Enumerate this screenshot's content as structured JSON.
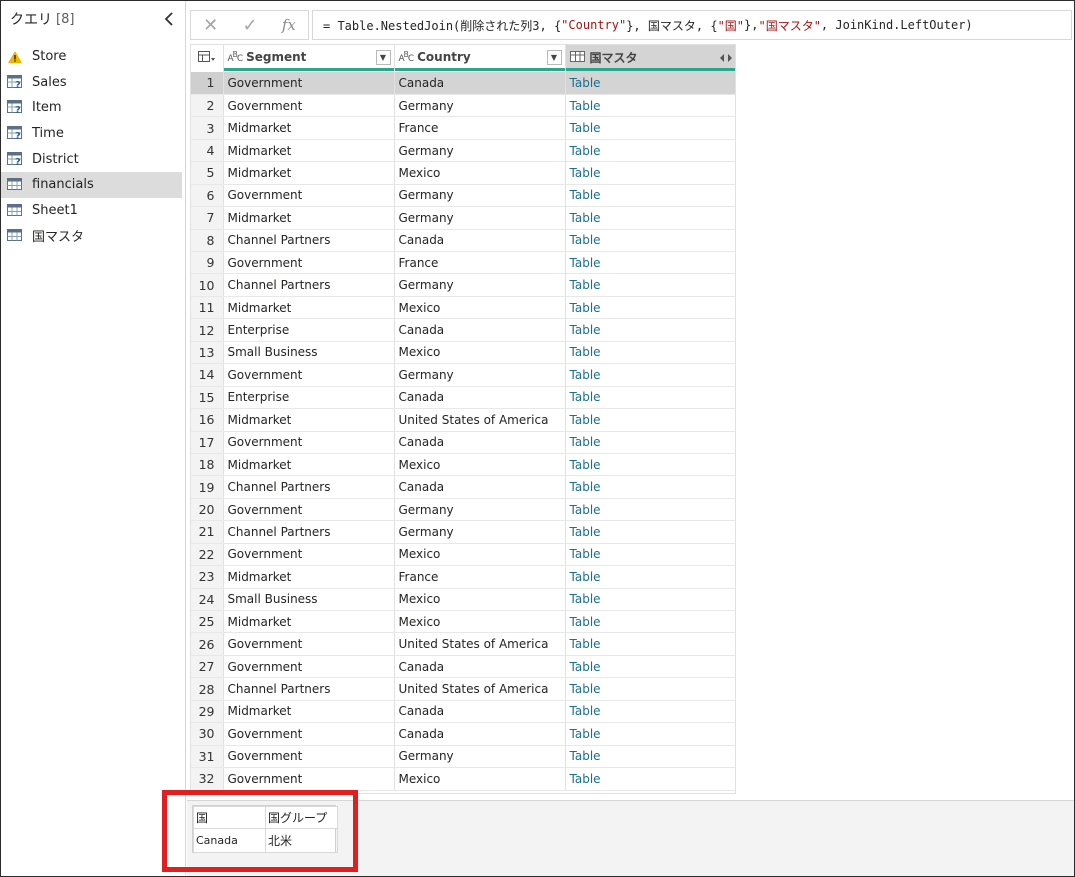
{
  "queries": {
    "title": "クエリ",
    "count": "[8]",
    "items": [
      {
        "label": "Store",
        "icon": "warning-icon"
      },
      {
        "label": "Sales",
        "icon": "query-table-icon"
      },
      {
        "label": "Item",
        "icon": "query-table-icon"
      },
      {
        "label": "Time",
        "icon": "query-table-icon"
      },
      {
        "label": "District",
        "icon": "query-table-icon"
      },
      {
        "label": "financials",
        "icon": "table-icon",
        "selected": true
      },
      {
        "label": "Sheet1",
        "icon": "table-icon"
      },
      {
        "label": "国マスタ",
        "icon": "table-icon"
      }
    ]
  },
  "formula_bar": {
    "cancel": "✕",
    "commit": "✓",
    "fx": "fx",
    "formula_parts": [
      {
        "t": "= Table.NestedJoin(削除された列3, {",
        "s": false
      },
      {
        "t": "\"Country\"",
        "s": true
      },
      {
        "t": "}, 国マスタ, {",
        "s": false
      },
      {
        "t": "\"国\"",
        "s": true
      },
      {
        "t": "}, ",
        "s": false
      },
      {
        "t": "\"国マスタ\"",
        "s": true
      },
      {
        "t": ", JoinKind.LeftOuter)",
        "s": false
      }
    ]
  },
  "grid": {
    "columns": [
      {
        "label": "Segment",
        "type_icon": "ABC"
      },
      {
        "label": "Country",
        "type_icon": "ABC"
      },
      {
        "label": "国マスタ",
        "type_icon": "table"
      }
    ],
    "rows": [
      [
        "1",
        "Government",
        "Canada",
        "Table"
      ],
      [
        "2",
        "Government",
        "Germany",
        "Table"
      ],
      [
        "3",
        "Midmarket",
        "France",
        "Table"
      ],
      [
        "4",
        "Midmarket",
        "Germany",
        "Table"
      ],
      [
        "5",
        "Midmarket",
        "Mexico",
        "Table"
      ],
      [
        "6",
        "Government",
        "Germany",
        "Table"
      ],
      [
        "7",
        "Midmarket",
        "Germany",
        "Table"
      ],
      [
        "8",
        "Channel Partners",
        "Canada",
        "Table"
      ],
      [
        "9",
        "Government",
        "France",
        "Table"
      ],
      [
        "10",
        "Channel Partners",
        "Germany",
        "Table"
      ],
      [
        "11",
        "Midmarket",
        "Mexico",
        "Table"
      ],
      [
        "12",
        "Enterprise",
        "Canada",
        "Table"
      ],
      [
        "13",
        "Small Business",
        "Mexico",
        "Table"
      ],
      [
        "14",
        "Government",
        "Germany",
        "Table"
      ],
      [
        "15",
        "Enterprise",
        "Canada",
        "Table"
      ],
      [
        "16",
        "Midmarket",
        "United States of America",
        "Table"
      ],
      [
        "17",
        "Government",
        "Canada",
        "Table"
      ],
      [
        "18",
        "Midmarket",
        "Mexico",
        "Table"
      ],
      [
        "19",
        "Channel Partners",
        "Canada",
        "Table"
      ],
      [
        "20",
        "Government",
        "Germany",
        "Table"
      ],
      [
        "21",
        "Channel Partners",
        "Germany",
        "Table"
      ],
      [
        "22",
        "Government",
        "Mexico",
        "Table"
      ],
      [
        "23",
        "Midmarket",
        "France",
        "Table"
      ],
      [
        "24",
        "Small Business",
        "Mexico",
        "Table"
      ],
      [
        "25",
        "Midmarket",
        "Mexico",
        "Table"
      ],
      [
        "26",
        "Government",
        "United States of America",
        "Table"
      ],
      [
        "27",
        "Government",
        "Canada",
        "Table"
      ],
      [
        "28",
        "Channel Partners",
        "United States of America",
        "Table"
      ],
      [
        "29",
        "Midmarket",
        "Canada",
        "Table"
      ],
      [
        "30",
        "Government",
        "Canada",
        "Table"
      ],
      [
        "31",
        "Government",
        "Germany",
        "Table"
      ],
      [
        "32",
        "Government",
        "Mexico",
        "Table"
      ]
    ]
  },
  "preview": {
    "headers": [
      "国",
      "国グループ"
    ],
    "row": [
      "Canada",
      "北米"
    ]
  },
  "colors": {
    "accent": "#2ca58d",
    "highlight": "#e02020",
    "table_link": "#1a6f8e"
  }
}
